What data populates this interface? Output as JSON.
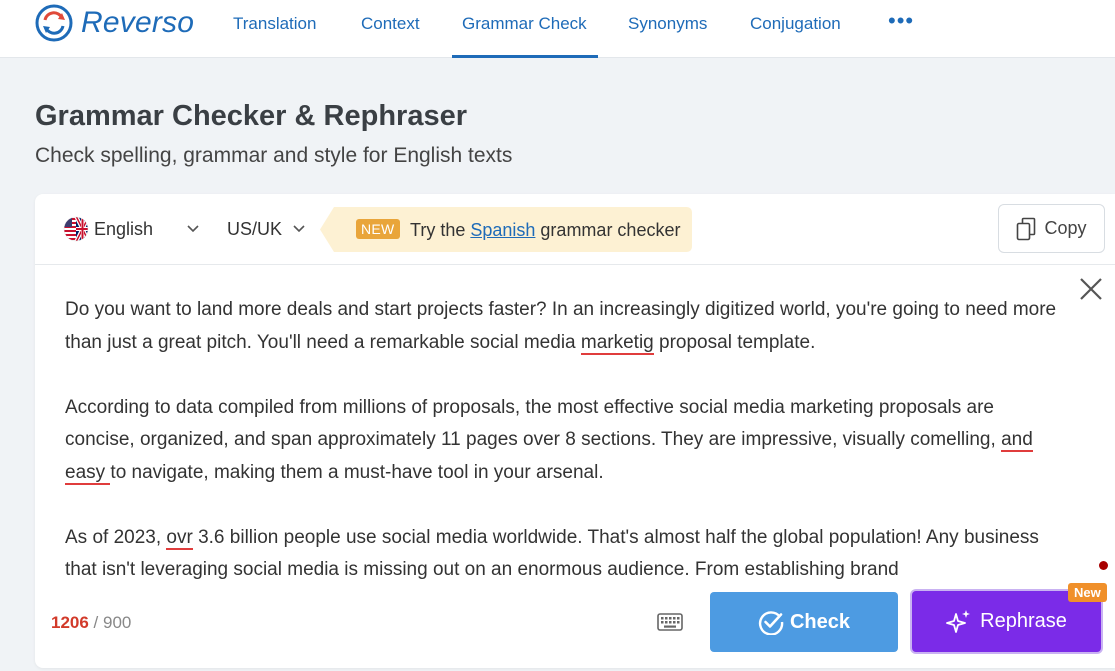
{
  "nav": {
    "brand": "Reverso",
    "items": [
      {
        "label": "Translation"
      },
      {
        "label": "Context"
      },
      {
        "label": "Grammar Check"
      },
      {
        "label": "Synonyms"
      },
      {
        "label": "Conjugation"
      }
    ],
    "active_item": "Grammar Check",
    "more": "•••"
  },
  "header": {
    "title": "Grammar Checker & Rephraser",
    "subtitle": "Check spelling, grammar and style for English texts"
  },
  "toolbar": {
    "language": "English",
    "variant": "US/UK",
    "promo_badge": "NEW",
    "promo_prefix": "Try the ",
    "promo_link": "Spanish",
    "promo_suffix": " grammar checker",
    "copy_label": "Copy"
  },
  "editor": {
    "p1_a": "Do you want to land more deals and start projects faster? In an increasingly digitized world, you're going to need more than just a great pitch. You'll need a remarkable social media ",
    "p1_err": "marketig",
    "p1_b": " proposal template.",
    "p2_a": "According to data compiled from millions of proposals, the most effective social media marketing proposals are concise, organized, and span approximately 11 pages over 8 sections. They are impressive, visually comelling, ",
    "p2_err": "and easy ",
    "p2_b": "to navigate, making them a must-have tool in your arsenal.",
    "p3_a": "As of 2023, ",
    "p3_err": "ovr",
    "p3_b": " 3.6 billion people use social media  worldwide. That's almost half the global population! Any business that isn't leveraging social media is missing out on an enormous audience. From establishing brand"
  },
  "footer": {
    "char_count": "1206",
    "char_limit": " / 900",
    "check_label": "Check",
    "rephrase_label": "Rephrase",
    "rephrase_tag": "New"
  },
  "colors": {
    "brand_blue": "#1e6bb8",
    "check_button": "#4d9be2",
    "rephrase_button": "#7b2be8",
    "error_underline": "#e03c3c",
    "promo_bg": "#fdf1d3",
    "new_badge": "#e9a53a"
  },
  "icons": [
    "reverso-logo-icon",
    "us-uk-flag-icon",
    "chevron-down-icon",
    "copy-icon",
    "close-icon",
    "keyboard-icon",
    "check-circle-icon",
    "sparkle-icon"
  ]
}
